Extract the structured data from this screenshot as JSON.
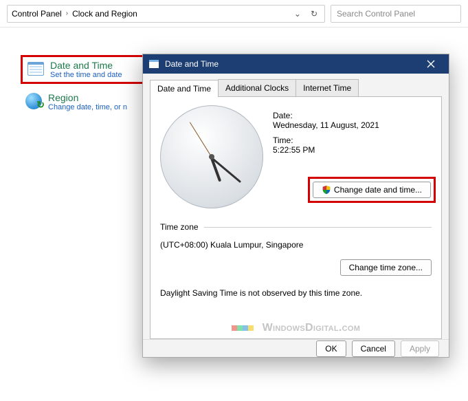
{
  "breadcrumb": {
    "root": "Control Panel",
    "current": "Clock and Region"
  },
  "search": {
    "placeholder": "Search Control Panel"
  },
  "sidebar": {
    "items": [
      {
        "title": "Date and Time",
        "subtitle": "Set the time and date"
      },
      {
        "title": "Region",
        "subtitle": "Change date, time, or n"
      }
    ]
  },
  "dialog": {
    "title": "Date and Time",
    "tabs": [
      "Date and Time",
      "Additional Clocks",
      "Internet Time"
    ],
    "date_label": "Date:",
    "date_value": "Wednesday, 11 August, 2021",
    "time_label": "Time:",
    "time_value": "5:22:55 PM",
    "change_dt_btn": "Change date and time...",
    "tz_heading": "Time zone",
    "tz_value": "(UTC+08:00) Kuala Lumpur, Singapore",
    "change_tz_btn": "Change time zone...",
    "dst_text": "Daylight Saving Time is not observed by this time zone.",
    "watermark": "WindowsDigital.com",
    "buttons": {
      "ok": "OK",
      "cancel": "Cancel",
      "apply": "Apply"
    }
  }
}
